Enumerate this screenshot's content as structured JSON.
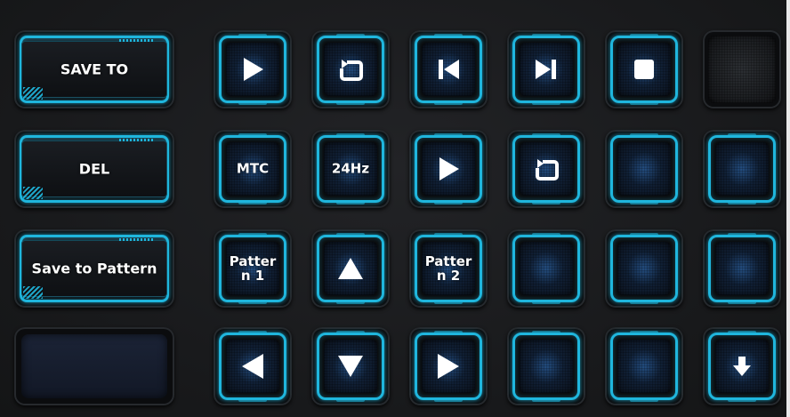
{
  "left_keys": [
    {
      "label": "SAVE TO"
    },
    {
      "label": "DEL"
    },
    {
      "label": "Save to Pattern"
    },
    {
      "label": ""
    }
  ],
  "grid": {
    "row1": [
      {
        "icon": "play-icon"
      },
      {
        "icon": "loop-icon"
      },
      {
        "icon": "skip-back-icon"
      },
      {
        "icon": "skip-forward-icon"
      },
      {
        "icon": "stop-icon"
      },
      {
        "icon": ""
      }
    ],
    "row2": [
      {
        "label": "MTC"
      },
      {
        "label": "24Hz"
      },
      {
        "icon": "play-icon"
      },
      {
        "icon": "loop-icon"
      },
      {
        "label": ""
      },
      {
        "label": ""
      }
    ],
    "row3": [
      {
        "label": "Patter\nn 1"
      },
      {
        "icon": "arrow-up-icon"
      },
      {
        "label": "Patter\nn 2"
      },
      {
        "label": ""
      },
      {
        "label": ""
      },
      {
        "label": ""
      }
    ],
    "row4": [
      {
        "icon": "arrow-left-icon"
      },
      {
        "icon": "arrow-down-icon"
      },
      {
        "icon": "arrow-right-icon"
      },
      {
        "label": ""
      },
      {
        "label": ""
      },
      {
        "icon": "down-arrow-icon"
      }
    ]
  },
  "colors": {
    "accent": "#1fb6dd",
    "background": "#1b1c1e",
    "glyph": "#ffffff"
  }
}
